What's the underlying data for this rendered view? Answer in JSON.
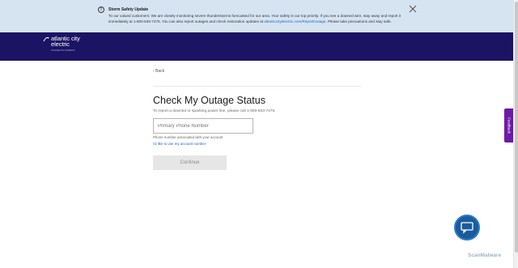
{
  "alert": {
    "title": "Storm Safety Update",
    "body_prefix": "To our valued customers: We are closely monitoring severe thunderstorms forecasted for our area. Your safety is our top priority. If you see a downed wire, stay away and report it immediately at 1-800-833-7476. You can also report outages and check restoration updates at ",
    "link": "atlanticcityelectric.com/ReportOutage",
    "body_suffix": ". Please take precautions and stay safe.",
    "info_icon": "info-circle-icon",
    "close_icon": "close-x-icon"
  },
  "header": {
    "logo_line1": "atlantic city",
    "logo_line2": "electric",
    "logo_sub": "AN EXELON COMPANY",
    "bg": "#1b1464"
  },
  "content": {
    "back_label": "Back",
    "title": "Check My Outage Status",
    "subtitle": "To report a downed or sparking power line, please call 1-800-833-7476.",
    "phone_placeholder": "Primary Phone Number",
    "phone_help": "Phone number associated with your account",
    "account_link": "I'd like to use my account number",
    "continue_label": "Continue"
  },
  "feedback_label": "Feedback",
  "watermark": "ScanMalware",
  "colors": {
    "alert_bg": "#d6e4f2",
    "link": "#1f63c4",
    "feedback": "#6f1aa6",
    "chat": "#1a5b9c"
  }
}
